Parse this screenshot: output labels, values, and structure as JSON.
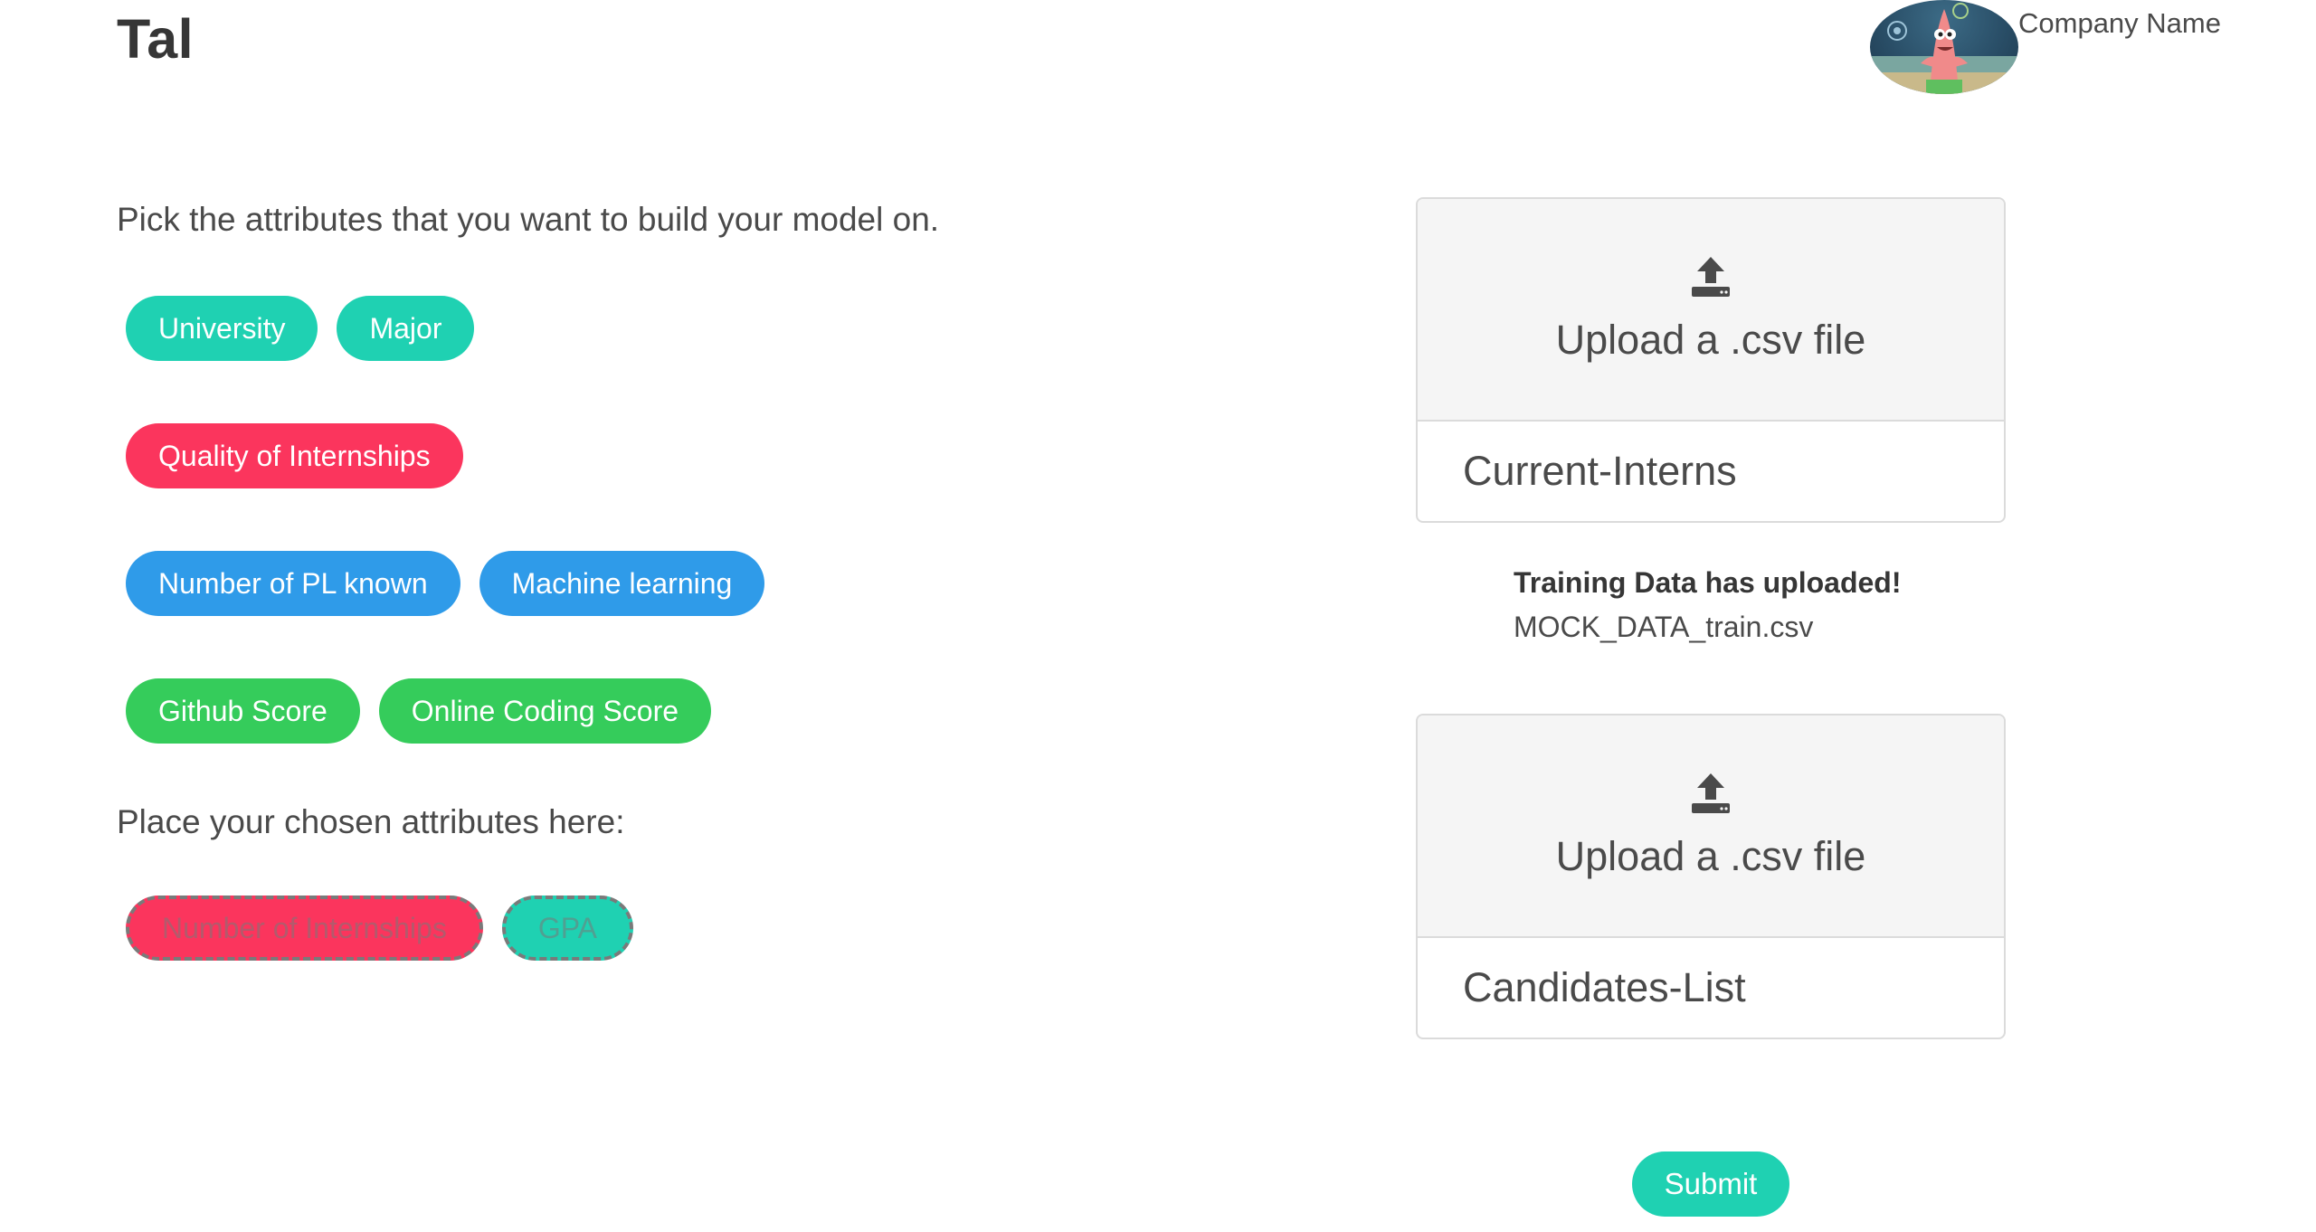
{
  "header": {
    "brand": "Tal",
    "company_name": "Company Name"
  },
  "left": {
    "prompt": "Pick the attributes that you want to build your model on.",
    "attribute_rows": [
      [
        {
          "label": "University",
          "color": "#1fd1b2"
        },
        {
          "label": "Major",
          "color": "#1fd1b2"
        }
      ],
      [
        {
          "label": "Quality of Internships",
          "color": "#fb355d"
        }
      ],
      [
        {
          "label": "Number of PL known",
          "color": "#2f9be9"
        },
        {
          "label": "Machine learning",
          "color": "#2f9be9"
        }
      ],
      [
        {
          "label": "Github Score",
          "color": "#35cc5b"
        },
        {
          "label": "Online Coding Score",
          "color": "#35cc5b"
        }
      ]
    ],
    "drop_label": "Place your chosen attributes here:",
    "chosen": [
      {
        "label": "Number of Internships",
        "color": "#fb355d"
      },
      {
        "label": "GPA",
        "color": "#1fd1b2"
      }
    ]
  },
  "right": {
    "training_upload": {
      "cta_label": "Upload a .csv file",
      "name": "Current-Interns",
      "icon": "upload-icon"
    },
    "status": {
      "title": "Training Data has uploaded!",
      "filename": "MOCK_DATA_train.csv"
    },
    "candidates_upload": {
      "cta_label": "Upload a .csv file",
      "name": "Candidates-List",
      "icon": "upload-icon"
    },
    "submit_label": "Submit"
  }
}
